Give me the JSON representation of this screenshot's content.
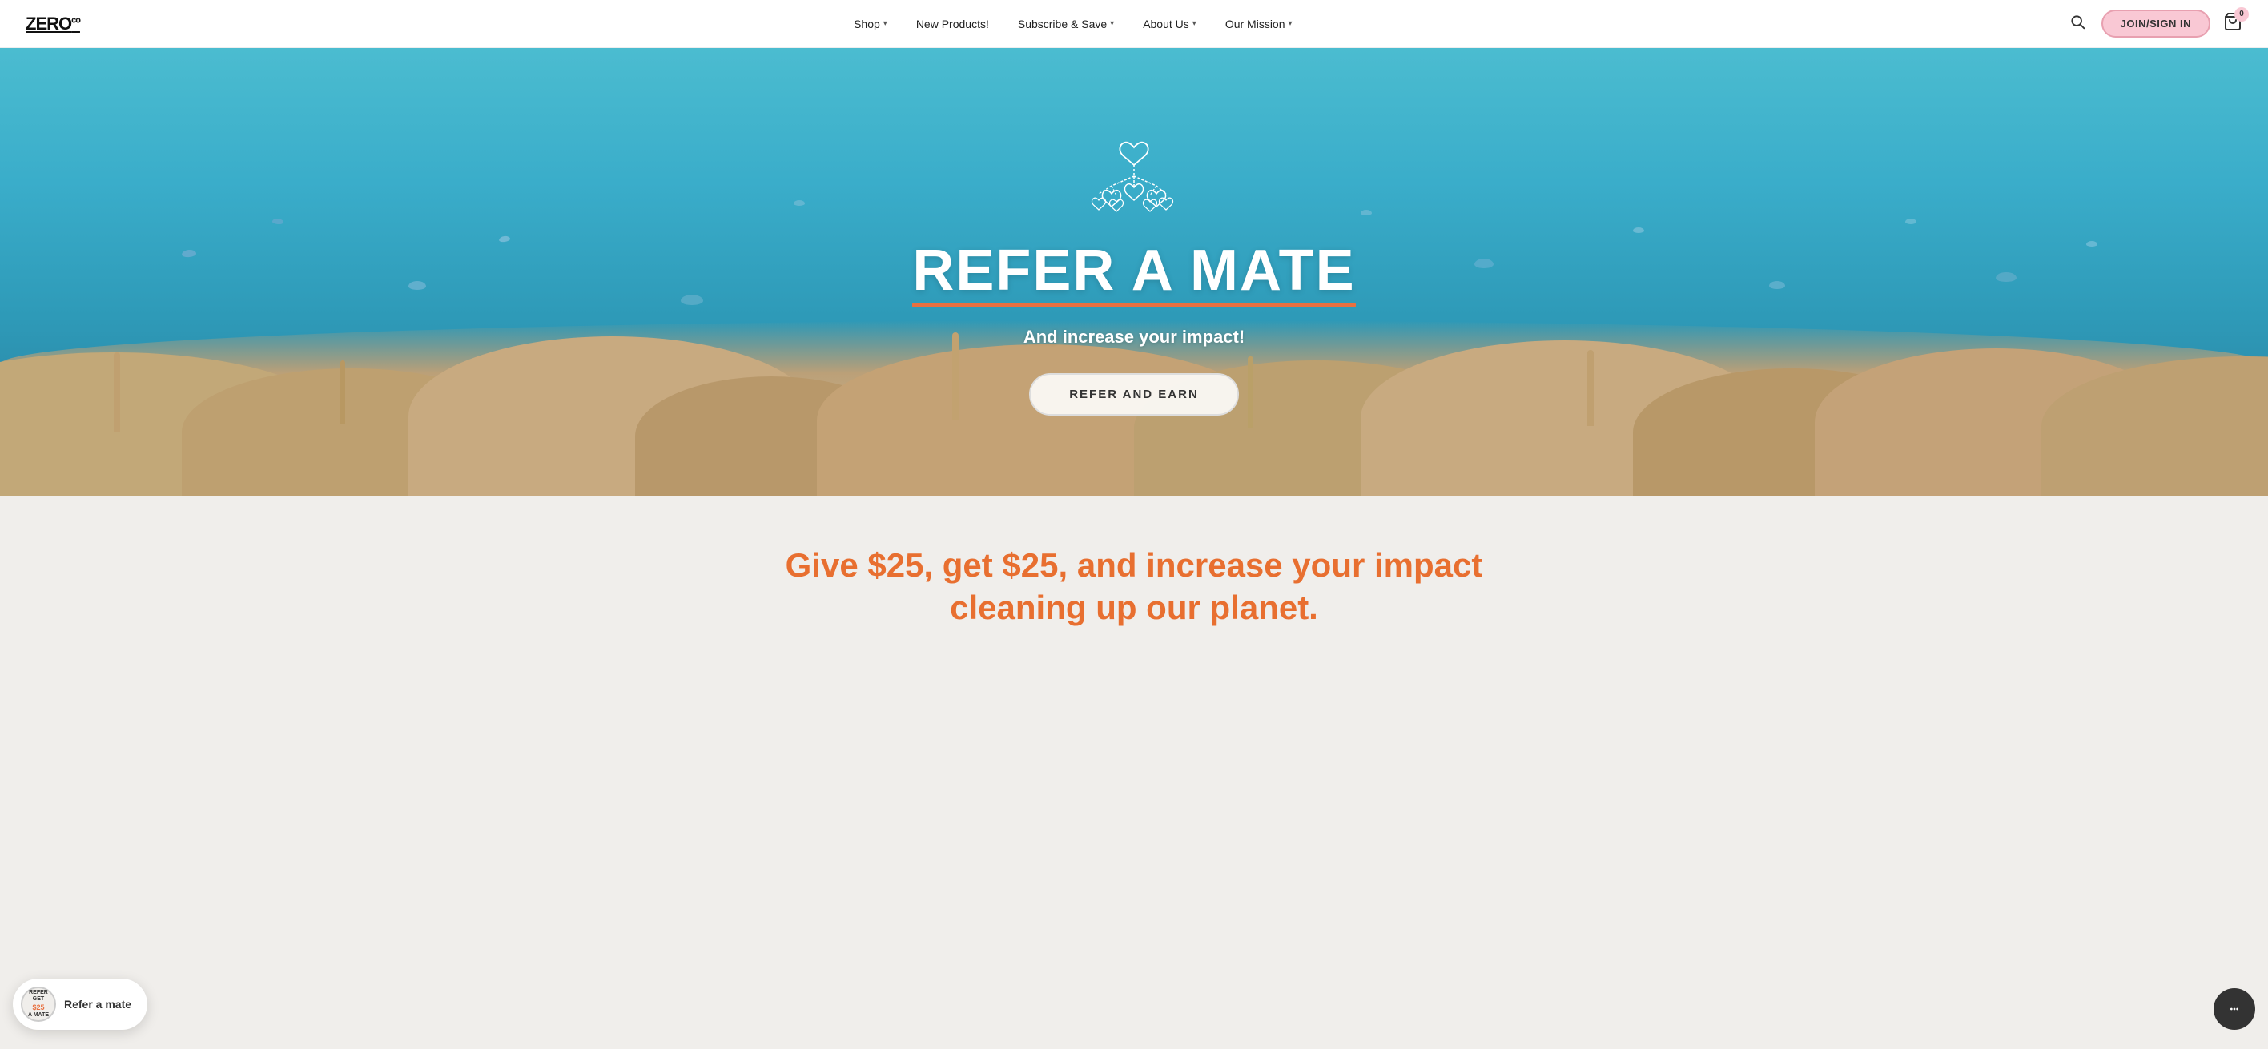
{
  "brand": {
    "name": "ZERO",
    "superscript": "co"
  },
  "nav": {
    "links": [
      {
        "label": "Shop",
        "hasDropdown": true
      },
      {
        "label": "New Products!",
        "hasDropdown": false
      },
      {
        "label": "Subscribe & Save",
        "hasDropdown": true
      },
      {
        "label": "About Us",
        "hasDropdown": true
      },
      {
        "label": "Our Mission",
        "hasDropdown": true
      }
    ],
    "join_label": "JOIN/SIGN IN",
    "cart_count": "0"
  },
  "hero": {
    "title": "REFER A MATE",
    "subtitle": "And increase your impact!",
    "cta_label": "REFER AND EARN"
  },
  "below_hero": {
    "text": "Give $25, get $25, and increase your impact cleaning up our planet."
  },
  "floating_widget": {
    "badge_line1": "REFER",
    "badge_line2": "Get",
    "badge_line3": "$25",
    "badge_line4": "A MATE",
    "label": "Refer a mate"
  }
}
